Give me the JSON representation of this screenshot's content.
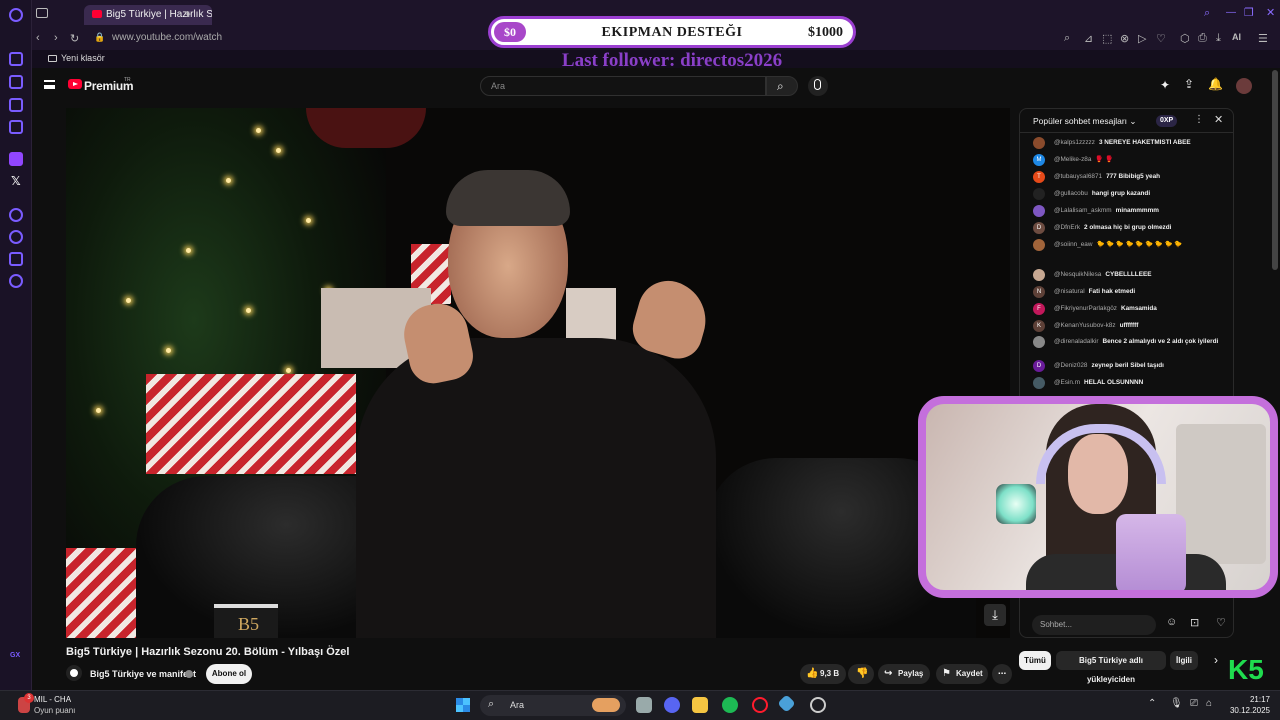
{
  "browser": {
    "tab_title": "Big5 Türkiye | Hazırlık S",
    "url": "www.youtube.com/watch",
    "bookmark_folder": "Yeni klasör",
    "gx_label": "GX",
    "ai_label": "AI"
  },
  "overlay": {
    "banner_left": "$0",
    "banner_title": "EKIPMAN DESTEĞI",
    "banner_right": "$1000",
    "last_follower": "Last follower: directos2026"
  },
  "youtube": {
    "brand": "Premium",
    "brand_sup": "TR",
    "search_placeholder": "Ara"
  },
  "video": {
    "title": "Big5 Türkiye | Hazırlık Sezonu 20. Bölüm - Yılbaşı Özel",
    "channel": "Big5 Türkiye ve manifest",
    "subscribe_label": "Abone ol",
    "likes": "9,3 B",
    "share_label": "Paylaş",
    "save_label": "Kaydet",
    "mug_logo": "B5"
  },
  "chat": {
    "header": "Popüler sohbet mesajları",
    "xp_badge": "0XP",
    "input_placeholder": "Sohbet...",
    "messages": [
      {
        "user": "@kalps1zzzzz",
        "text": "3 NEREYE HAKETMISTI ABEE",
        "initial": "",
        "color": "#8a4b2c"
      },
      {
        "user": "@Melike-z8a",
        "text": "🥊 🥊",
        "initial": "M",
        "color": "#1e88e5"
      },
      {
        "user": "@tubauysal6871",
        "text": "777 Bibibig5 yeah",
        "initial": "T",
        "color": "#e64a19"
      },
      {
        "user": "@gullacobu",
        "text": "hangi grup kazandi",
        "initial": "",
        "color": "#222222"
      },
      {
        "user": "@Lalalisam_askmm",
        "text": "minammmmm",
        "initial": "",
        "color": "#7e57c2"
      },
      {
        "user": "@DfnErk",
        "text": "2 olmasa hiç bi grup olmezdi",
        "initial": "D",
        "color": "#6d4c41"
      },
      {
        "user": "@soiinn_eaw",
        "text": "🐤 🐤 🐤 🐤 🐤 🐤 🐤 🐤 🐤",
        "initial": "",
        "color": "#a1643a"
      },
      {
        "user": "@NesquikNilesa",
        "text": "CYBELLLLEEE",
        "initial": "",
        "color": "#c7a892"
      },
      {
        "user": "@nisatural",
        "text": "Fati hak etmedi",
        "initial": "N",
        "color": "#5d4037"
      },
      {
        "user": "@FikriyenurParlakgöz",
        "text": "Kamsamida",
        "initial": "F",
        "color": "#c2185b"
      },
      {
        "user": "@KenanYusubov-k8z",
        "text": "ufffffff",
        "initial": "K",
        "color": "#5d4037"
      },
      {
        "user": "@direnaladalkir",
        "text": "Bence 2 almalıydı ve 2 aldı çok iyilerdi",
        "initial": "",
        "color": "#888888"
      },
      {
        "user": "@Deniz028",
        "text": "zeynep beril Sibel taşıdı",
        "initial": "D",
        "color": "#6a1b9a"
      },
      {
        "user": "@Esin.m",
        "text": "HELAL OLSUNNNN",
        "initial": "",
        "color": "#455a64"
      }
    ]
  },
  "chips": {
    "all": "Tümü",
    "uploader": "Big5 Türkiye adlı yükleyiciden",
    "related": "İlgili"
  },
  "brand_logo": "K5",
  "taskbar": {
    "weather_title": "MIL - CHA",
    "weather_sub": "Oyun puanı",
    "weather_badge": "3",
    "search_label": "Ara",
    "time": "21:17",
    "date": "30.12.2025"
  }
}
